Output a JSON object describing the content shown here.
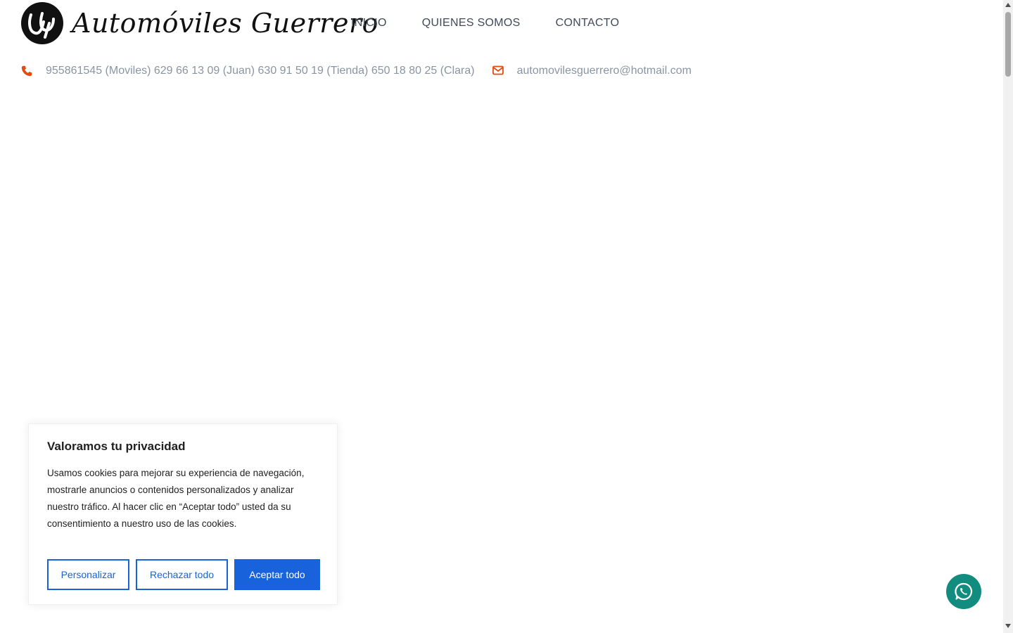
{
  "header": {
    "logo_text": "Automóviles Guerrero",
    "nav": [
      {
        "label": "INICIO"
      },
      {
        "label": "QUIENES SOMOS"
      },
      {
        "label": "CONTACTO"
      }
    ]
  },
  "contact": {
    "phone_text": "955861545 (Moviles) 629 66 13 09 (Juan) 630 91 50 19 (Tienda) 650 18 80 25 (Clara)",
    "email_text": "automovilesguerrero@hotmail.com",
    "icons": {
      "phone": "phone-icon",
      "email": "envelope-icon"
    },
    "icon_color": "#e8490f"
  },
  "cookie": {
    "title": "Valoramos tu privacidad",
    "body": "Usamos cookies para mejorar su experiencia de navegación, mostrarle anuncios o contenidos personalizados y analizar nuestro tráfico. Al hacer clic en “Aceptar todo” usted da su consentimiento a nuestro uso de las cookies.",
    "buttons": {
      "customize": "Personalizar",
      "reject": "Rechazar todo",
      "accept": "Aceptar todo"
    },
    "accent_color": "#1863dc"
  },
  "whatsapp": {
    "icon": "whatsapp-icon",
    "color": "#128c7e"
  }
}
